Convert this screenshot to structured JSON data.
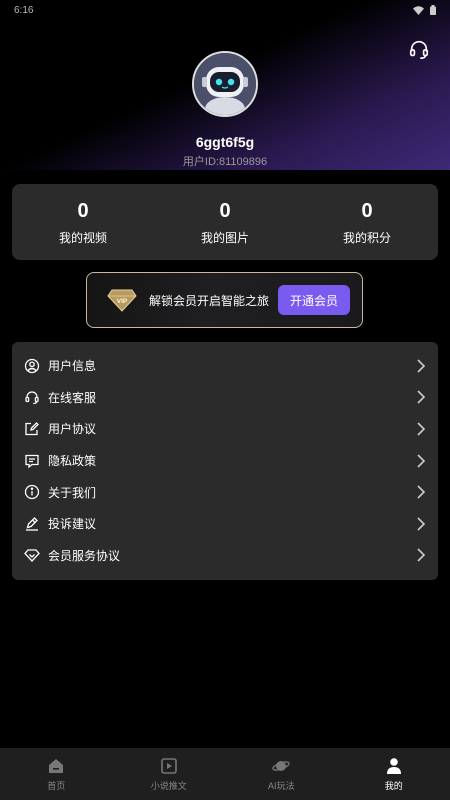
{
  "status_bar": {
    "time": "6:16"
  },
  "colors": {
    "accent": "#7a5bf0",
    "card_bg": "#2b2b2b",
    "vip_border": "#c9b89a"
  },
  "header": {
    "support_icon": "headset-icon"
  },
  "profile": {
    "avatar_icon": "robot-avatar",
    "username": "6ggt6f5g",
    "user_id_label": "用户ID:",
    "user_id": "81109896"
  },
  "stats": [
    {
      "value": "0",
      "label": "我的视频"
    },
    {
      "value": "0",
      "label": "我的图片"
    },
    {
      "value": "0",
      "label": "我的积分"
    }
  ],
  "vip": {
    "badge": "VIP",
    "text": "解锁会员开启智能之旅",
    "button": "开通会员"
  },
  "menu": [
    {
      "label": "用户信息",
      "icon": "user-circle-icon"
    },
    {
      "label": "在线客服",
      "icon": "headset-icon"
    },
    {
      "label": "用户协议",
      "icon": "edit-document-icon"
    },
    {
      "label": "隐私政策",
      "icon": "message-square-icon"
    },
    {
      "label": "关于我们",
      "icon": "info-circle-icon"
    },
    {
      "label": "投诉建议",
      "icon": "feedback-icon"
    },
    {
      "label": "会员服务协议",
      "icon": "diamond-heart-icon"
    }
  ],
  "tabs": [
    {
      "label": "首页",
      "icon": "home-icon"
    },
    {
      "label": "小说推文",
      "icon": "video-book-icon"
    },
    {
      "label": "AI玩法",
      "icon": "planet-icon"
    },
    {
      "label": "我的",
      "icon": "person-icon",
      "active": true
    }
  ]
}
